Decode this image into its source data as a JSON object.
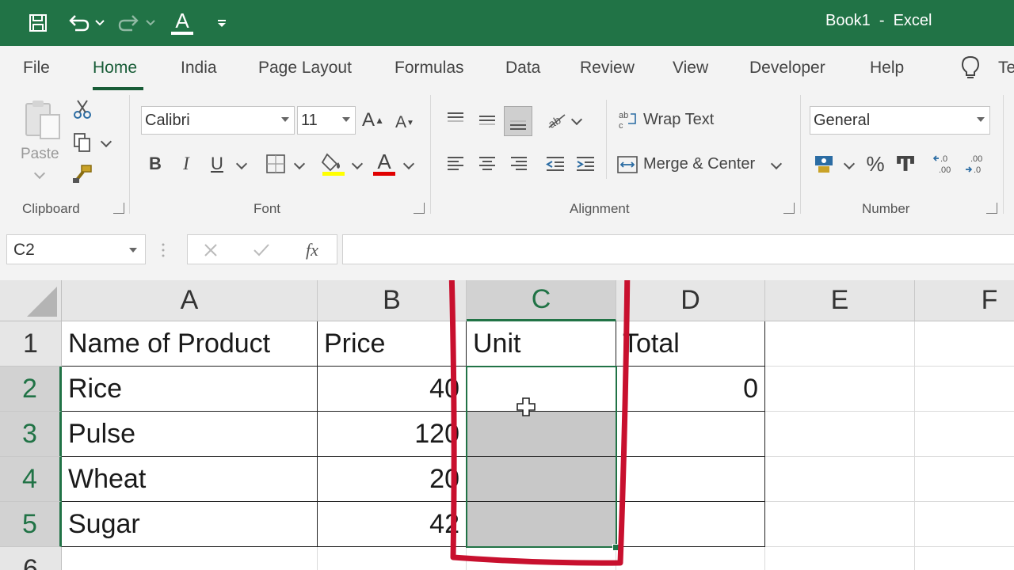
{
  "window": {
    "title": "Book1  -  Excel"
  },
  "quick_access": {
    "icons": [
      "save-icon",
      "undo-icon",
      "redo-icon",
      "font-color-icon",
      "customize-icon"
    ],
    "font_color_glyph": "A"
  },
  "tabs": [
    "File",
    "Home",
    "India",
    "Page Layout",
    "Formulas",
    "Data",
    "Review",
    "View",
    "Developer",
    "Help",
    "Te"
  ],
  "active_tab": "Home",
  "ribbon": {
    "clipboard": {
      "label": "Clipboard",
      "paste_label": "Paste"
    },
    "font": {
      "label": "Font",
      "font_name": "Calibri",
      "font_size": "11",
      "bold": "B",
      "italic": "I",
      "underline": "U"
    },
    "alignment": {
      "label": "Alignment",
      "wrap_text": "Wrap Text",
      "merge_center": "Merge & Center"
    },
    "number": {
      "label": "Number",
      "format": "General",
      "percent": "%",
      "comma": "Ͳ"
    }
  },
  "formula_bar": {
    "name_box": "C2",
    "fx": "fx",
    "formula": ""
  },
  "sheet": {
    "columns": [
      "A",
      "B",
      "C",
      "D",
      "E",
      "F"
    ],
    "rows": [
      "1",
      "2",
      "3",
      "4",
      "5",
      "6"
    ],
    "selected_column": "C",
    "cells": {
      "A1": "Name of Product",
      "B1": "Price",
      "C1": "Unit",
      "D1": "Total",
      "A2": "Rice",
      "B2": "40",
      "D2": "0",
      "A3": "Pulse",
      "B3": "120",
      "A4": "Wheat",
      "B4": "20",
      "A5": "Sugar",
      "B5": "42"
    }
  },
  "colors": {
    "excel_green": "#217346",
    "annotation_red": "#c8102e",
    "selection_gray": "#c8c8c8"
  }
}
